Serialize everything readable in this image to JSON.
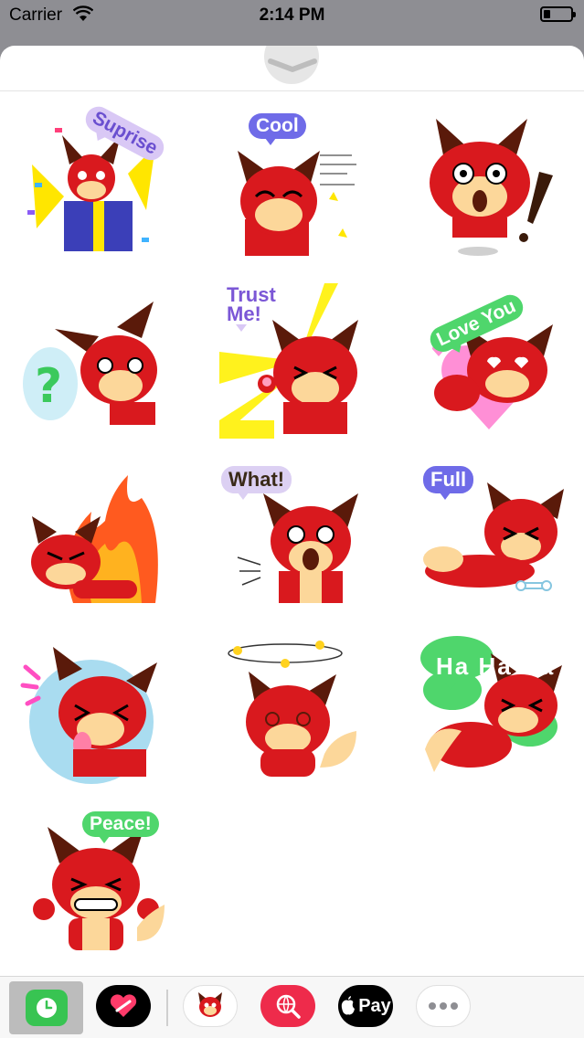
{
  "status_bar": {
    "carrier": "Carrier",
    "time": "2:14 PM",
    "battery_level": 0.25
  },
  "sheet": {
    "grabber_icon": "chevron-down-icon"
  },
  "stickers": [
    {
      "caption": "Suprise"
    },
    {
      "caption": "Cool"
    },
    {
      "caption": ""
    },
    {
      "caption": ""
    },
    {
      "caption": "Trust\nMe!"
    },
    {
      "caption": "Love You"
    },
    {
      "caption": ""
    },
    {
      "caption": "What!"
    },
    {
      "caption": "Full"
    },
    {
      "caption": ""
    },
    {
      "caption": ""
    },
    {
      "caption": "Ha Ha Ha"
    },
    {
      "caption": "Peace!"
    }
  ],
  "app_drawer": {
    "items": [
      {
        "name": "recents",
        "icon": "clock-icon",
        "color": "#38c452"
      },
      {
        "name": "digital-touch",
        "icon": "heart-icon",
        "color": "#000000"
      },
      {
        "name": "fox-stickers",
        "icon": "fox-icon",
        "color": "#ffffff"
      },
      {
        "name": "images-search",
        "icon": "globe-search-icon",
        "color": "#ee2b4b"
      },
      {
        "name": "apple-pay",
        "icon": "apple-icon",
        "label": "Pay",
        "color": "#000000"
      },
      {
        "name": "more",
        "icon": "ellipsis-icon",
        "color": "#ffffff"
      }
    ]
  }
}
